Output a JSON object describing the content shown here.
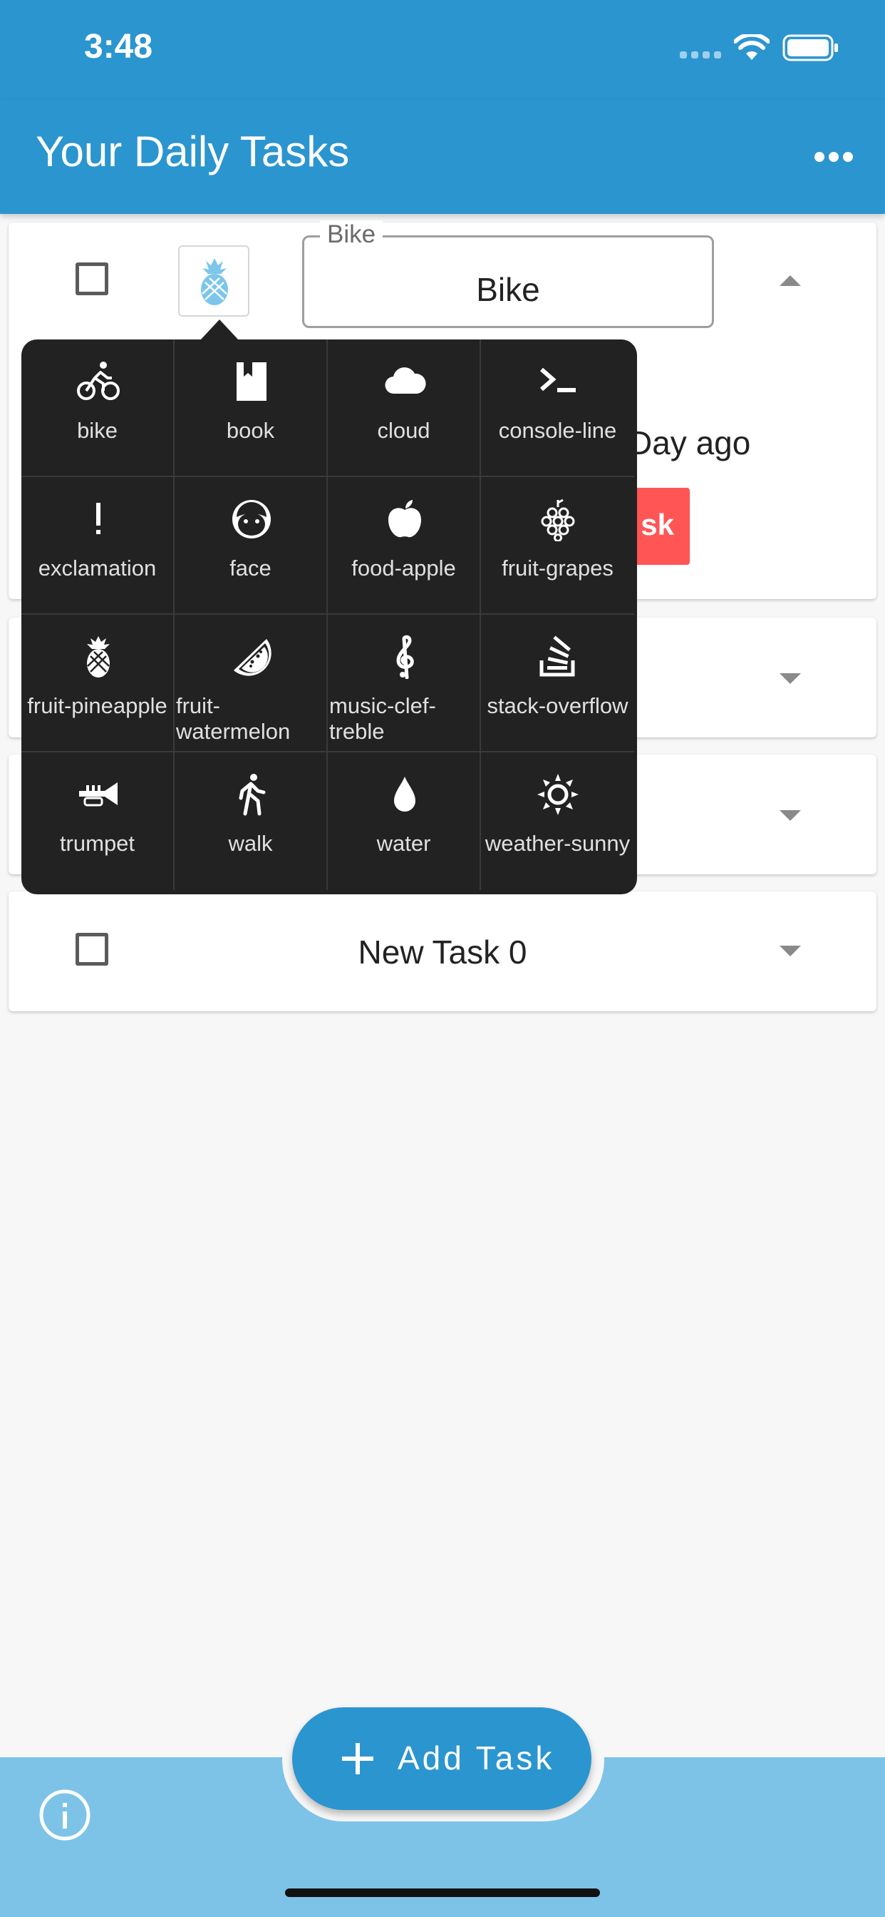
{
  "status_bar": {
    "time": "3:48"
  },
  "app_bar": {
    "title": "Your Daily Tasks",
    "menu_icon": "more-horizontal-icon"
  },
  "tasks": [
    {
      "field_label": "Bike",
      "field_value": "Bike",
      "selected_icon": "fruit-pineapple-icon",
      "time_ago_visible": "Day ago",
      "delete_visible": "sk",
      "expanded": true
    },
    {
      "title": "New Task 0",
      "expanded": false
    }
  ],
  "icon_picker": {
    "items": [
      {
        "label": "bike",
        "icon": "bike-icon"
      },
      {
        "label": "book",
        "icon": "book-icon"
      },
      {
        "label": "cloud",
        "icon": "cloud-icon"
      },
      {
        "label": "console-line",
        "icon": "console-line-icon"
      },
      {
        "label": "exclamation",
        "icon": "exclamation-icon"
      },
      {
        "label": "face",
        "icon": "face-icon"
      },
      {
        "label": "food-apple",
        "icon": "food-apple-icon"
      },
      {
        "label": "fruit-grapes",
        "icon": "fruit-grapes-icon"
      },
      {
        "label": "fruit-pineapple",
        "icon": "fruit-pineapple-icon"
      },
      {
        "label": "fruit-watermelon",
        "line1": "fruit-",
        "line2": "watermelon",
        "icon": "fruit-watermelon-icon"
      },
      {
        "label": "music-clef-treble",
        "line1": "music-clef-",
        "line2": "treble",
        "icon": "music-clef-treble-icon"
      },
      {
        "label": "stack-overflow",
        "icon": "stack-overflow-icon"
      },
      {
        "label": "trumpet",
        "icon": "trumpet-icon"
      },
      {
        "label": "walk",
        "icon": "walk-icon"
      },
      {
        "label": "water",
        "icon": "water-icon"
      },
      {
        "label": "weather-sunny",
        "icon": "weather-sunny-icon"
      }
    ]
  },
  "fab": {
    "label": "Add Task",
    "icon": "plus-icon"
  },
  "bottom_bar": {
    "info_icon": "info-icon"
  },
  "colors": {
    "primary": "#2b95cf",
    "bottom_bar": "#7dc3e8",
    "danger": "#ff5555",
    "popup_bg": "#222222",
    "accent_icon": "#7cc6ec"
  }
}
